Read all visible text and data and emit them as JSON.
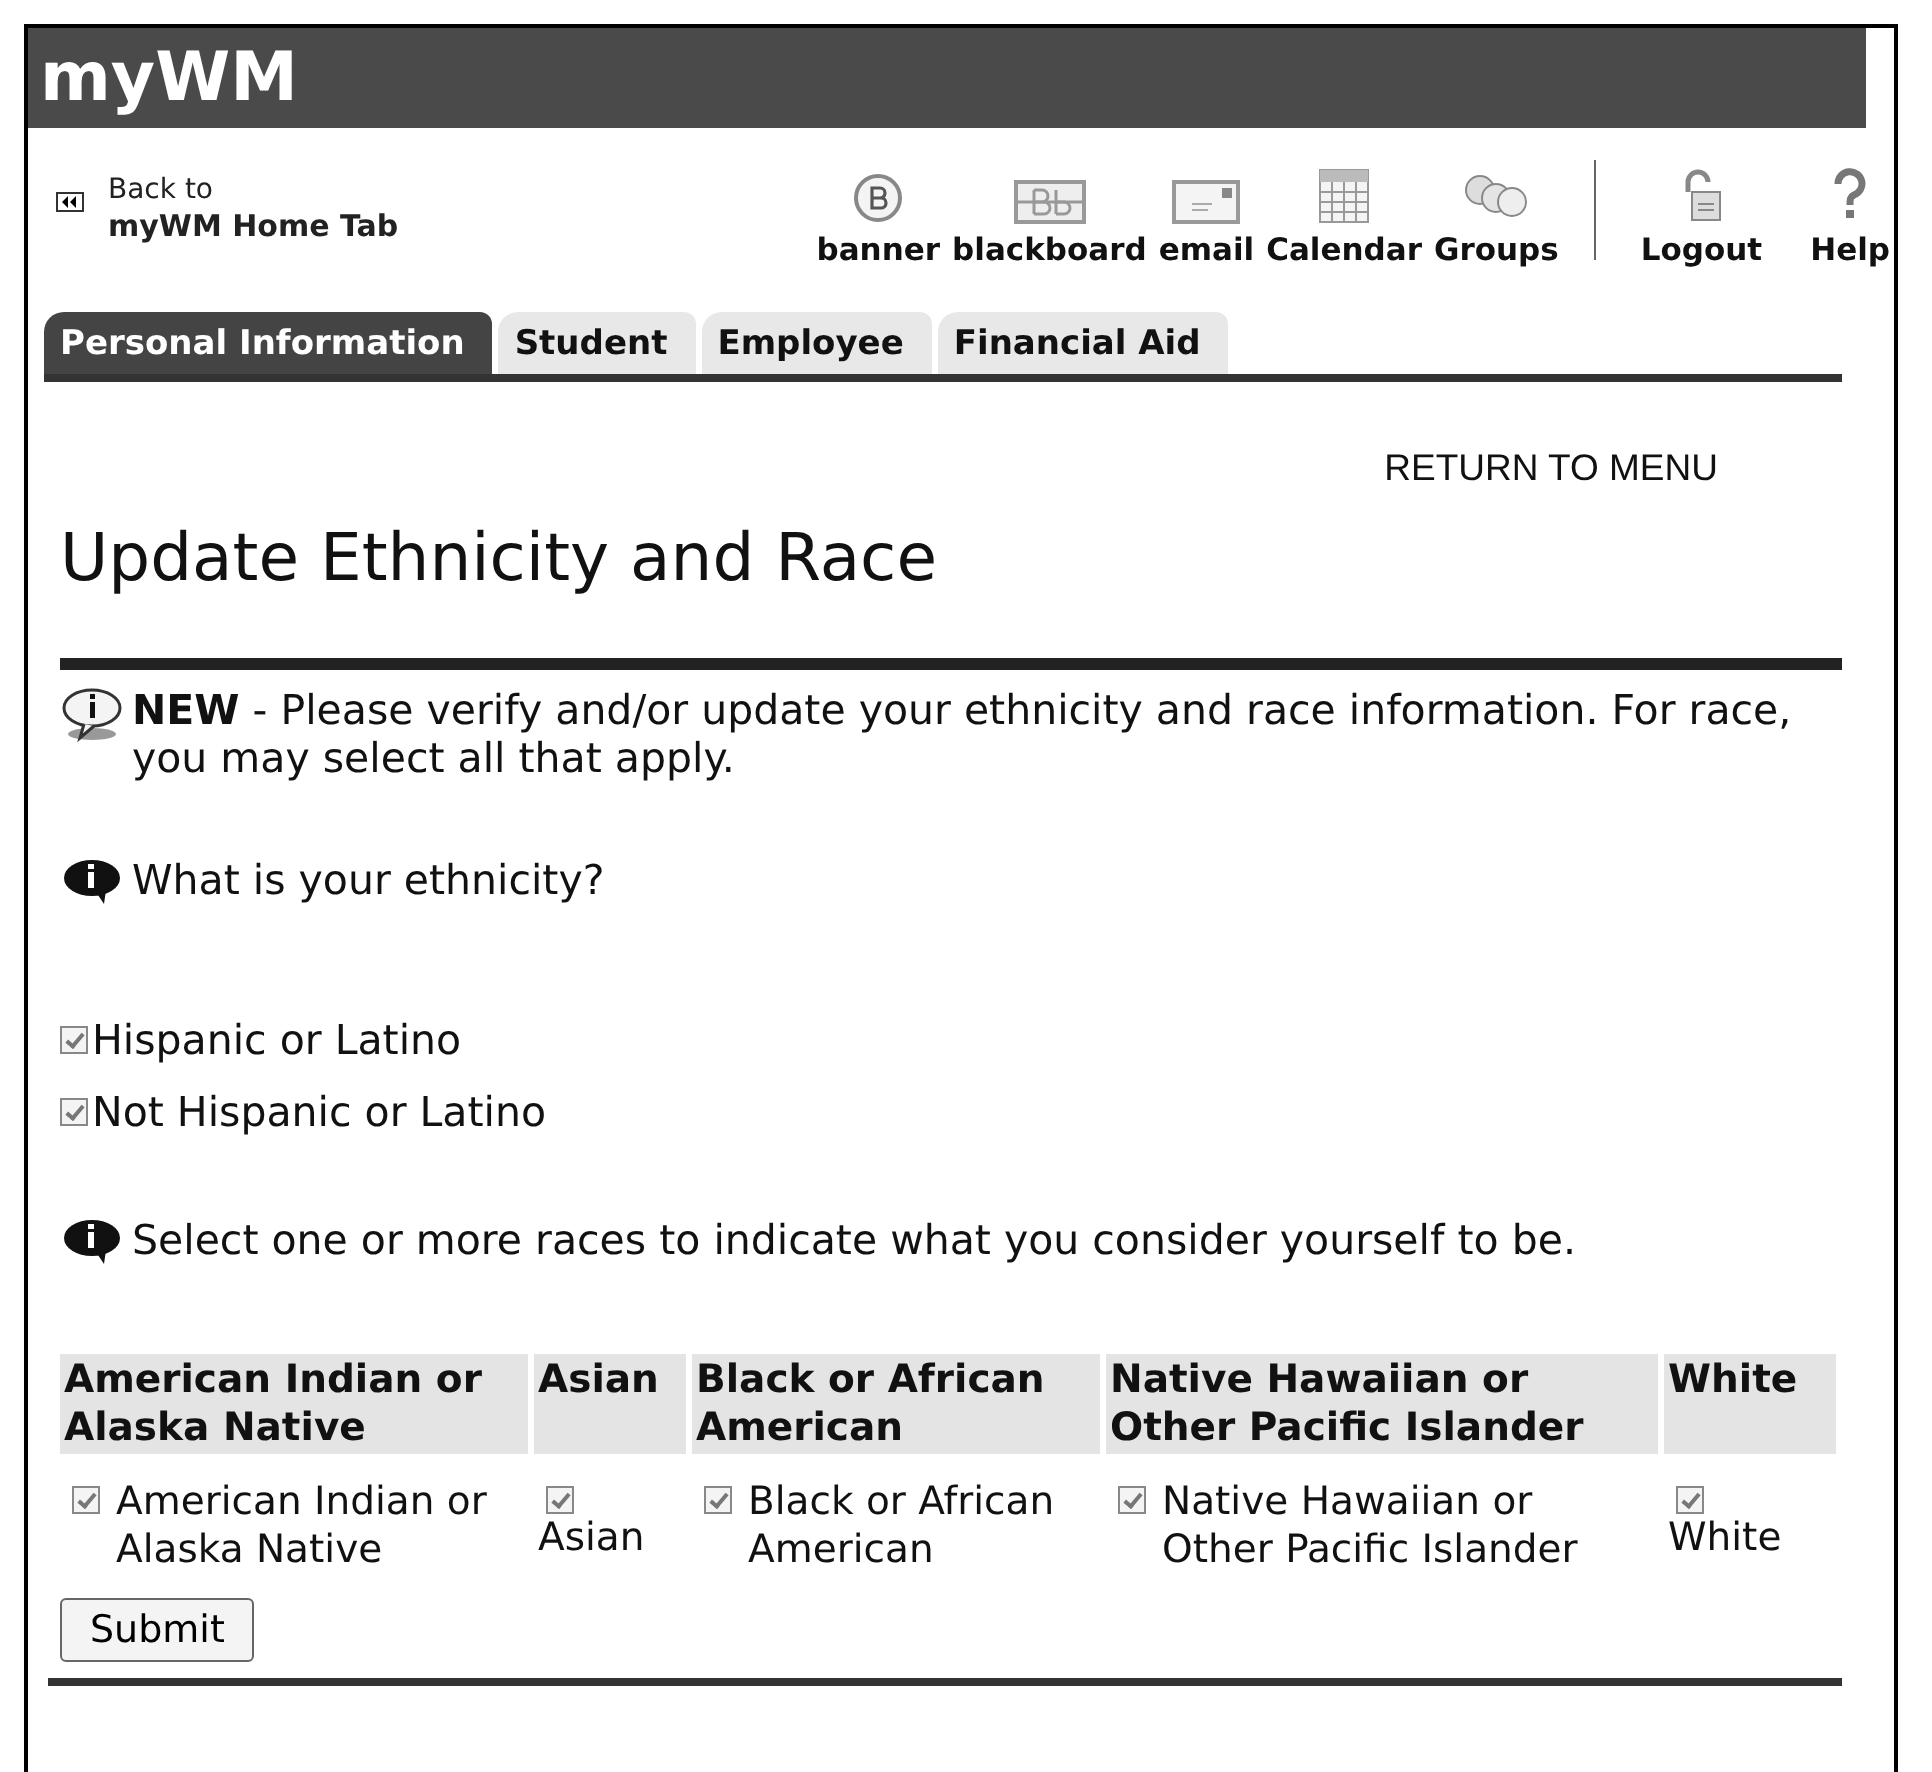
{
  "header": {
    "logo": "myWM"
  },
  "back_link": {
    "line1": "Back to",
    "line2": "myWM Home Tab"
  },
  "toolbar": [
    {
      "kind": "banner",
      "label": "banner"
    },
    {
      "kind": "blackboard",
      "label": "blackboard"
    },
    {
      "kind": "email",
      "label": "email"
    },
    {
      "kind": "calendar",
      "label": "Calendar"
    },
    {
      "kind": "groups",
      "label": "Groups"
    },
    {
      "kind": "logout",
      "label": "Logout"
    },
    {
      "kind": "help",
      "label": "Help"
    }
  ],
  "tabs": [
    {
      "label": "Personal Information",
      "selected": true
    },
    {
      "label": "Student",
      "selected": false
    },
    {
      "label": "Employee",
      "selected": false
    },
    {
      "label": "Financial Aid",
      "selected": false
    }
  ],
  "return_link": "RETURN TO MENU",
  "title": "Update Ethnicity and Race",
  "notice": "**NEW** - Please verify and/or update your ethnicity and race information. For race, you may select all that apply.",
  "ethnicity_question": "What is your ethnicity?",
  "ethnicity_options": [
    {
      "label": "Hispanic or Latino",
      "checked": true
    },
    {
      "label": "Not Hispanic or Latino",
      "checked": true
    }
  ],
  "race_question": "Select one or more races to indicate what you consider yourself to be.",
  "races": [
    {
      "header": "American Indian or Alaska Native",
      "label": "American Indian or Alaska Native",
      "checked": true
    },
    {
      "header": "Asian",
      "label": "Asian",
      "checked": true
    },
    {
      "header": "Black or African American",
      "label": "Black or African American",
      "checked": true
    },
    {
      "header": "Native Hawaiian or Other Pacific Islander",
      "label": "Native Hawaiian or Other Pacific Islander",
      "checked": true
    },
    {
      "header": "White",
      "label": "White",
      "checked": true
    }
  ],
  "submit": "Submit"
}
